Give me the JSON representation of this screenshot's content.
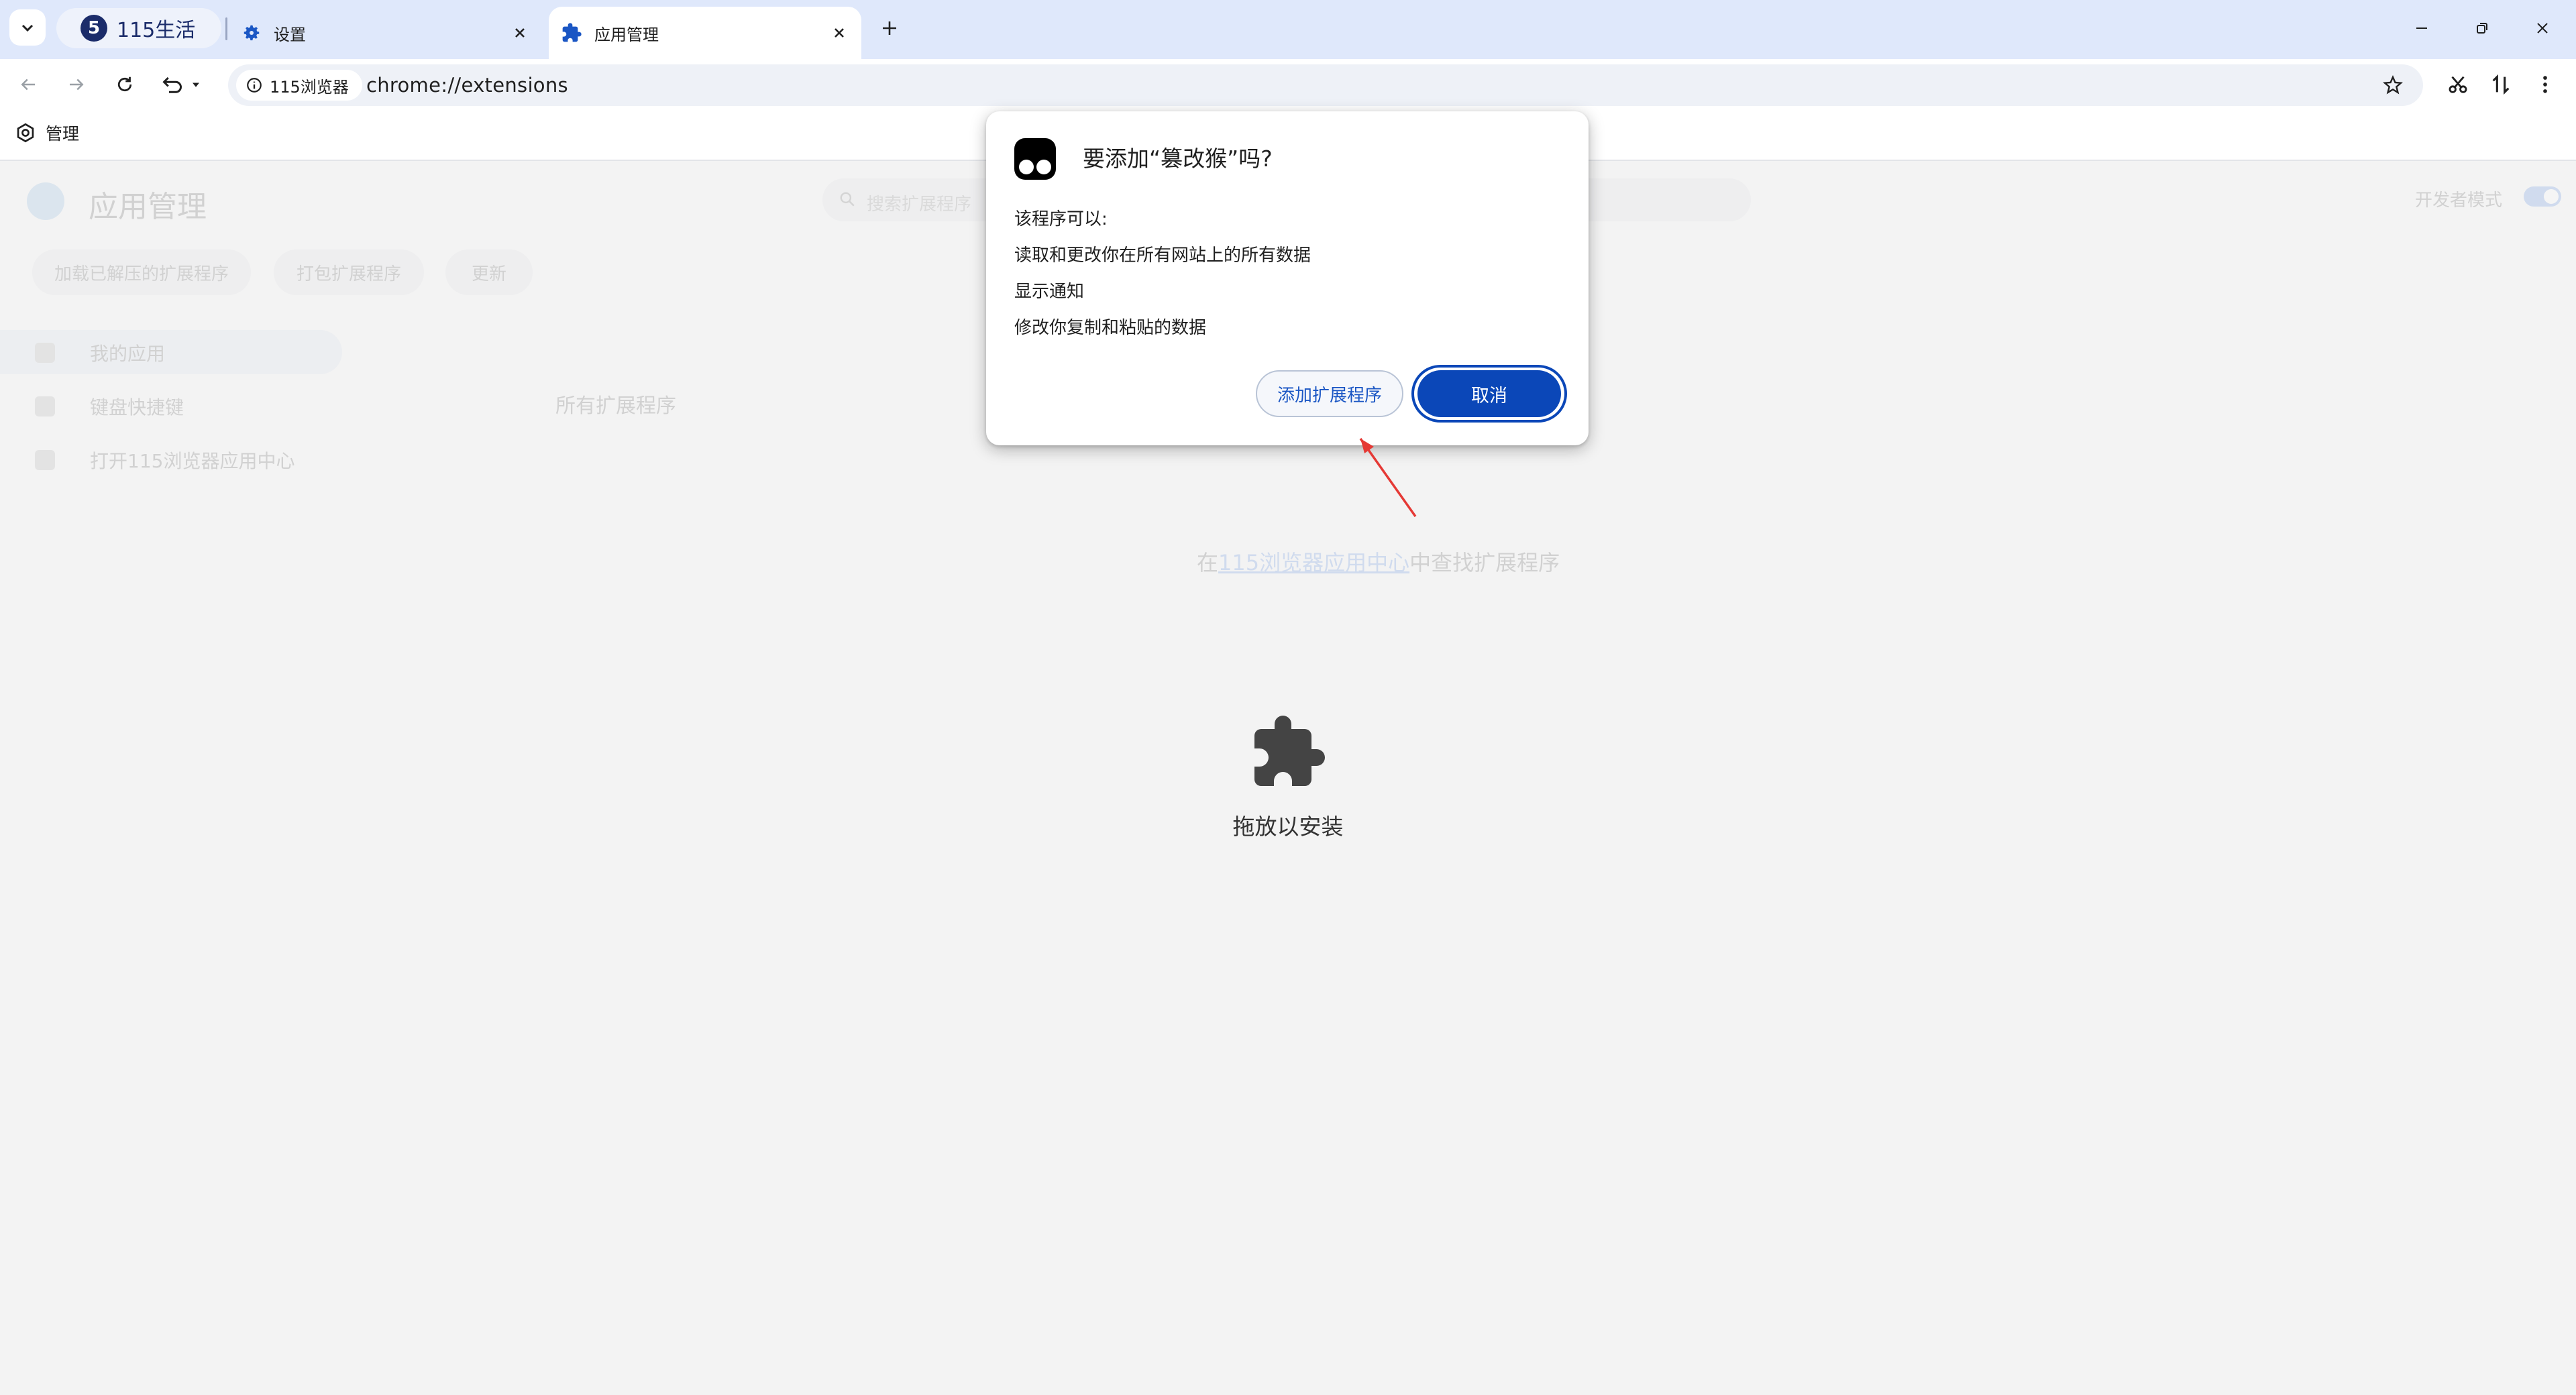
{
  "tabs": {
    "items": [
      {
        "label": "115生活",
        "icon": "115-logo-icon",
        "logo_text": "5"
      },
      {
        "label": "设置",
        "icon": "gear-icon"
      },
      {
        "label": "应用管理",
        "icon": "puzzle-icon",
        "active": true
      }
    ],
    "new_tab_glyph": "+"
  },
  "toolbar": {
    "site_chip_label": "115浏览器",
    "url": "chrome://extensions"
  },
  "bookmarks": {
    "manage_label": "管理"
  },
  "page": {
    "title": "应用管理",
    "search_placeholder": "搜索扩展程序",
    "dev_mode_label": "开发者模式",
    "dev_mode_on": true,
    "buttons": [
      "加载已解压的扩展程序",
      "打包扩展程序",
      "更新"
    ],
    "sidebar": [
      "我的应用",
      "键盘快捷键",
      "打开115浏览器应用中心"
    ],
    "all_extensions_label": "所有扩展程序",
    "find_prefix": "在",
    "find_link": "115浏览器应用中心",
    "find_suffix": "中查找扩展程序",
    "drop_label": "拖放以安装"
  },
  "dialog": {
    "title": "要添加“篡改猴”吗?",
    "intro": "该程序可以:",
    "permissions": [
      "读取和更改你在所有网站上的所有数据",
      "显示通知",
      "修改你复制和粘贴的数据"
    ],
    "add_button": "添加扩展程序",
    "cancel_button": "取消"
  },
  "colors": {
    "accent": "#0b47b8",
    "tabstrip": "#dfe8fb",
    "annotation_arrow": "#e53935"
  }
}
